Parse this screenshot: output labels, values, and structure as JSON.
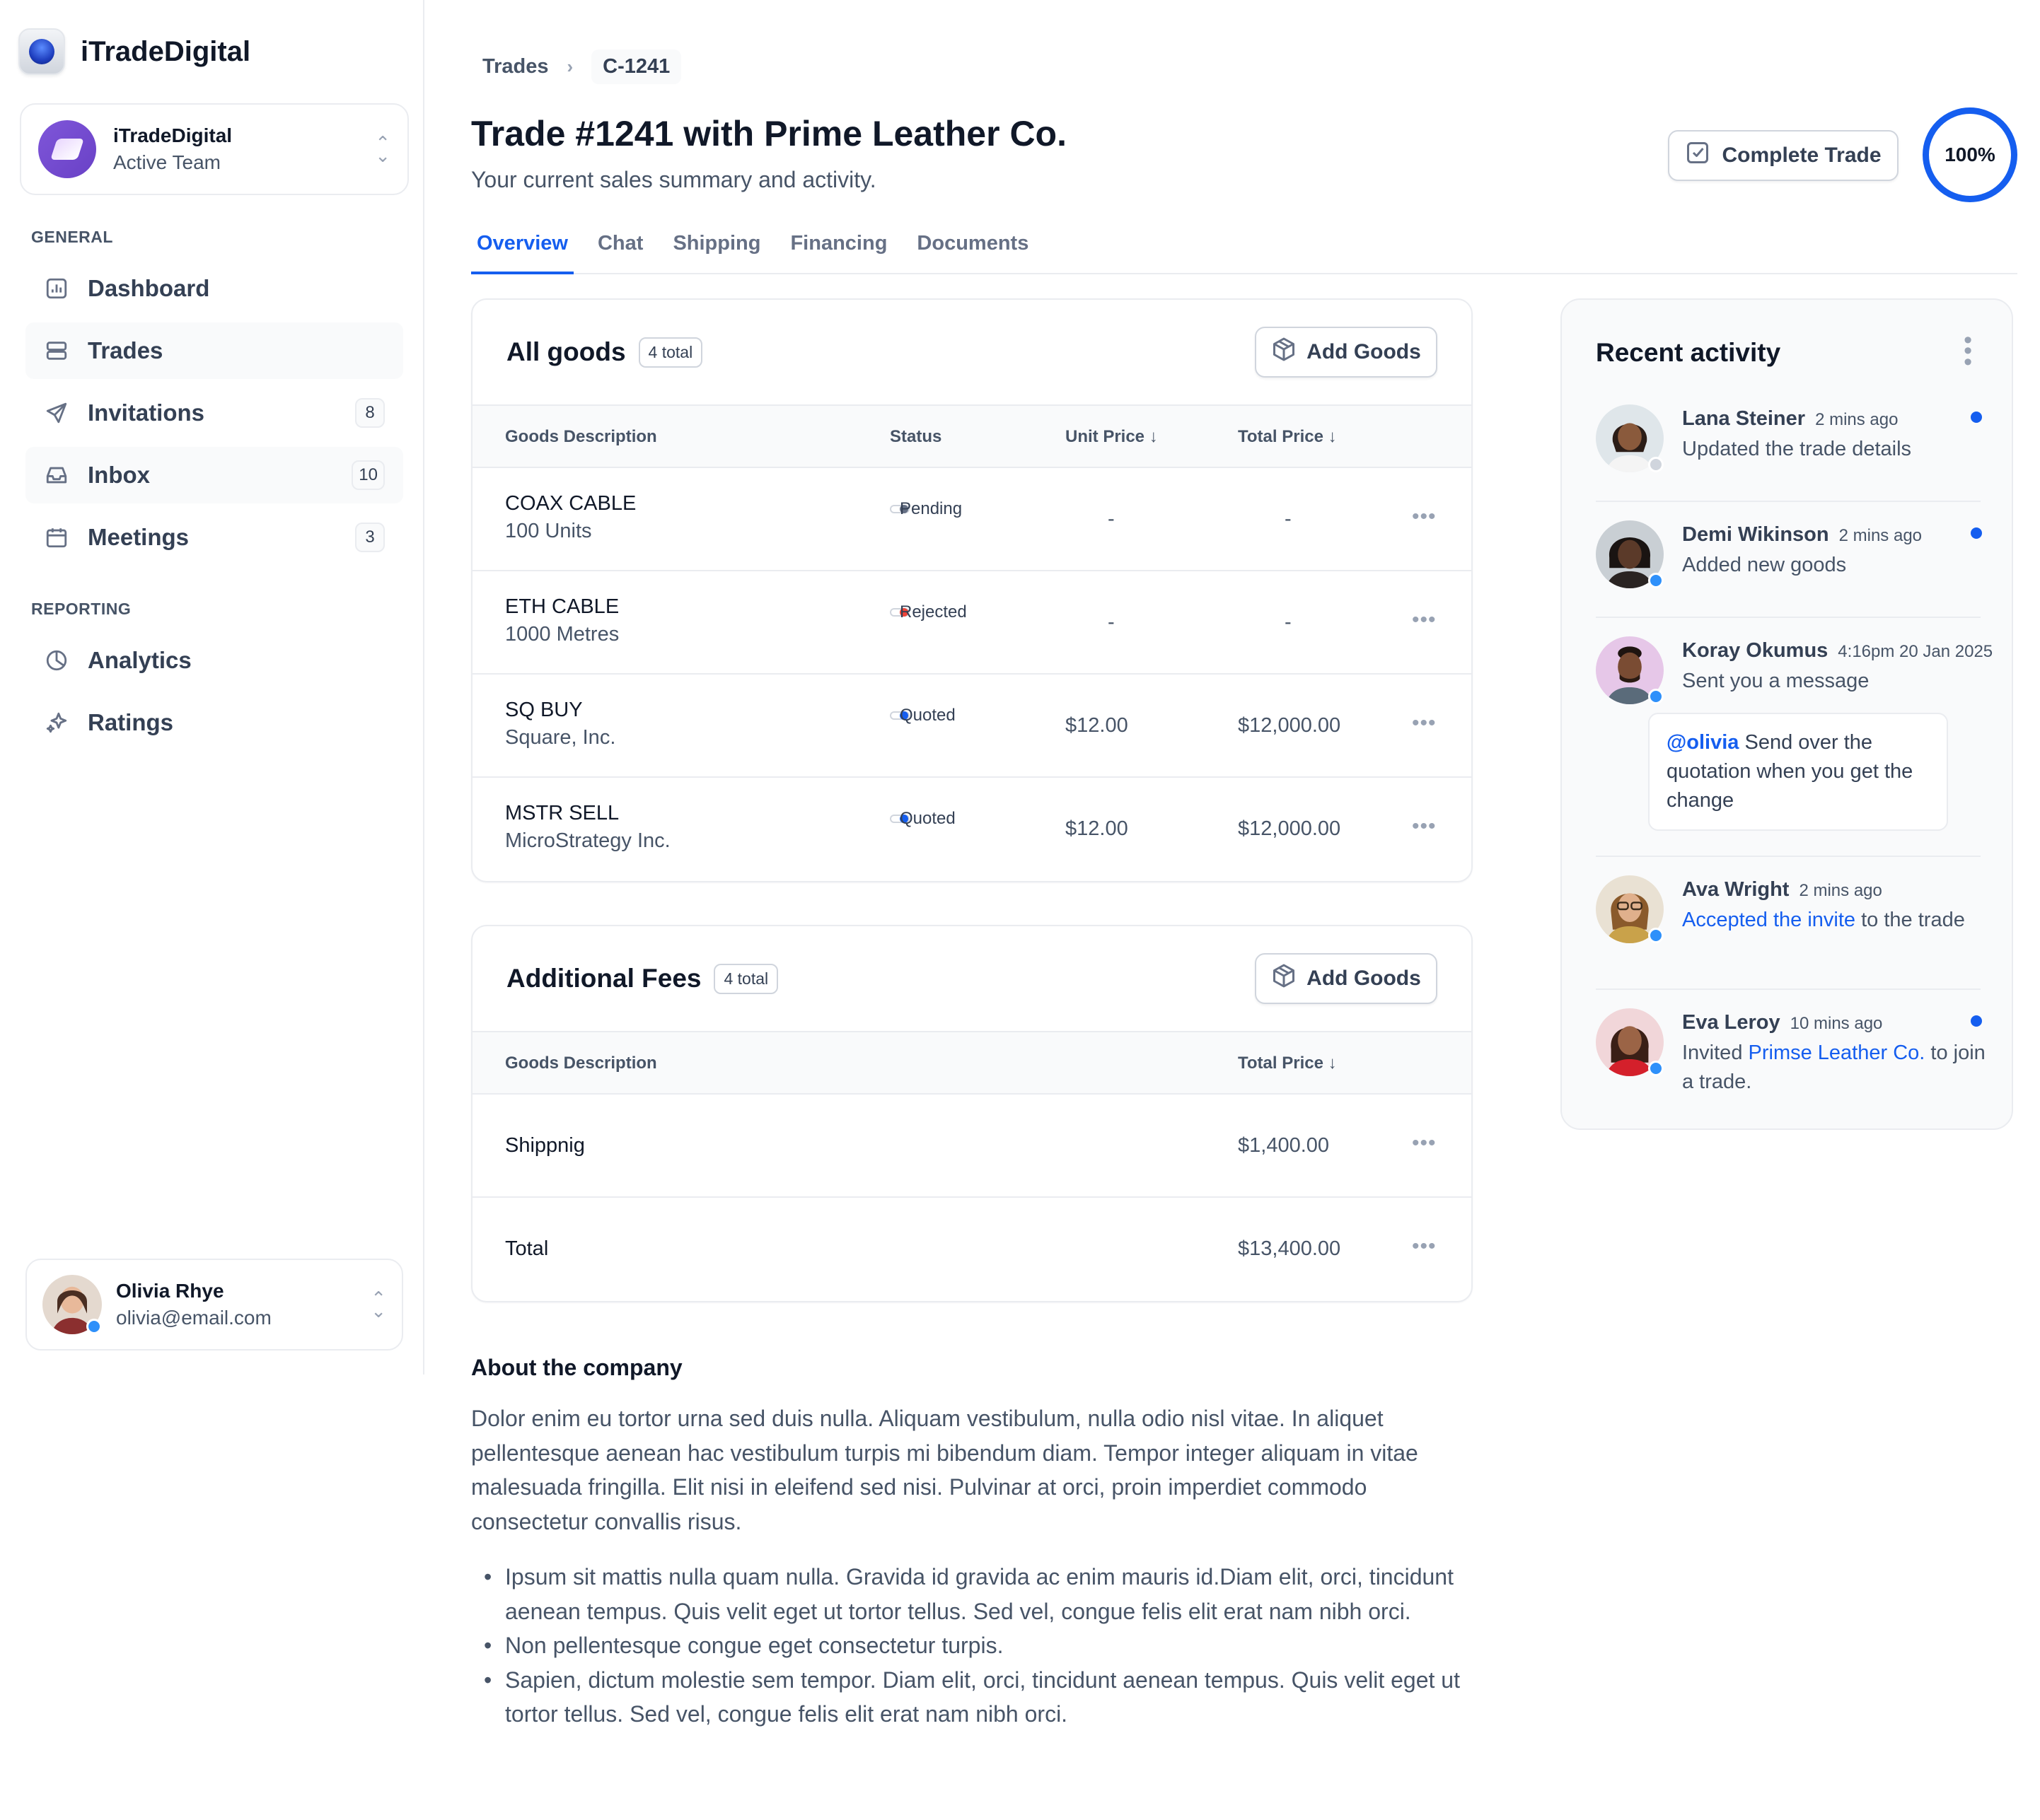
{
  "app": {
    "name": "iTradeDigital"
  },
  "team": {
    "name": "iTradeDigital",
    "subtitle": "Active Team"
  },
  "sidebar": {
    "sections": [
      {
        "label": "GENERAL"
      },
      {
        "label": "REPORTING"
      }
    ],
    "items": [
      {
        "label": "Dashboard",
        "icon": "bar-chart-icon"
      },
      {
        "label": "Trades",
        "icon": "server-icon"
      },
      {
        "label": "Invitations",
        "icon": "send-icon",
        "badge": "8"
      },
      {
        "label": "Inbox",
        "icon": "inbox-icon",
        "badge": "10"
      },
      {
        "label": "Meetings",
        "icon": "calendar-icon",
        "badge": "3"
      },
      {
        "label": "Analytics",
        "icon": "pie-chart-icon"
      },
      {
        "label": "Ratings",
        "icon": "stars-icon"
      }
    ]
  },
  "user": {
    "name": "Olivia Rhye",
    "email": "olivia@email.com"
  },
  "breadcrumb": {
    "parent": "Trades",
    "current": "C-1241"
  },
  "header": {
    "title": "Trade #1241 with Prime Leather Co.",
    "subtitle": "Your current sales summary and activity.",
    "complete_label": "Complete Trade",
    "progress_label": "100%",
    "progress_value": 100
  },
  "tabs": [
    {
      "label": "Overview",
      "active": true
    },
    {
      "label": "Chat"
    },
    {
      "label": "Shipping"
    },
    {
      "label": "Financing"
    },
    {
      "label": "Documents"
    }
  ],
  "goods": {
    "title": "All goods",
    "count": "4 total",
    "add_label": "Add Goods",
    "columns": [
      "Goods Description",
      "Status",
      "Unit Price",
      "Total Price"
    ],
    "rows": [
      {
        "name": "COAX CABLE",
        "sub": "100 Units",
        "status": "Pending",
        "status_color": "#667085",
        "unit": "-",
        "total": "-"
      },
      {
        "name": "ETH CABLE",
        "sub": "1000 Metres",
        "status": "Rejected",
        "status_color": "#f04438",
        "unit": "-",
        "total": "-"
      },
      {
        "name": "SQ BUY",
        "sub": "Square, Inc.",
        "status": "Quoted",
        "status_color": "#155eef",
        "unit": "$12.00",
        "total": "$12,000.00"
      },
      {
        "name": "MSTR SELL",
        "sub": "MicroStrategy Inc.",
        "status": "Quoted",
        "status_color": "#155eef",
        "unit": "$12.00",
        "total": "$12,000.00"
      }
    ]
  },
  "fees": {
    "title": "Additional Fees",
    "count": "4 total",
    "add_label": "Add Goods",
    "columns": [
      "Goods Description",
      "Total Price"
    ],
    "rows": [
      {
        "name": "Shippnig",
        "total": "$1,400.00"
      },
      {
        "name": "Total",
        "total": "$13,400.00"
      }
    ]
  },
  "about": {
    "title": "About the company",
    "body": "Dolor enim eu tortor urna sed duis nulla. Aliquam vestibulum, nulla odio nisl vitae. In aliquet pellentesque aenean hac vestibulum turpis mi bibendum diam. Tempor integer aliquam in vitae malesuada fringilla. Elit nisi in eleifend sed nisi. Pulvinar at orci, proin imperdiet commodo consectetur convallis risus.",
    "bullets": [
      "Ipsum sit mattis nulla quam nulla. Gravida id gravida ac enim mauris id.Diam elit, orci, tincidunt aenean tempus. Quis velit eget ut tortor tellus. Sed vel, congue felis elit erat nam nibh orci.",
      "Non pellentesque congue eget consectetur turpis.",
      "Sapien, dictum molestie sem tempor. Diam elit, orci, tincidunt aenean tempus. Quis velit eget ut tortor tellus. Sed vel, congue felis elit erat nam nibh orci."
    ]
  },
  "activity": {
    "title": "Recent activity",
    "items": [
      {
        "name": "Lana Steiner",
        "time": "2 mins ago",
        "text": "Updated the trade details"
      },
      {
        "name": "Demi Wikinson",
        "time": "2 mins ago",
        "text": "Added new goods"
      },
      {
        "name": "Koray Okumus",
        "time": "4:16pm 20 Jan 2025",
        "text": "Sent you a message",
        "quote_mention": "@olivia",
        "quote_text": "Send over the quotation when you get the change"
      },
      {
        "name": "Ava Wright",
        "time": "2 mins ago",
        "link": "Accepted the invite",
        "text_after": "to the trade"
      },
      {
        "name": "Eva Leroy",
        "time": "10 mins ago",
        "text_before": "Invited",
        "link": "Primse Leather Co.",
        "text_after": "to join a trade."
      }
    ]
  }
}
